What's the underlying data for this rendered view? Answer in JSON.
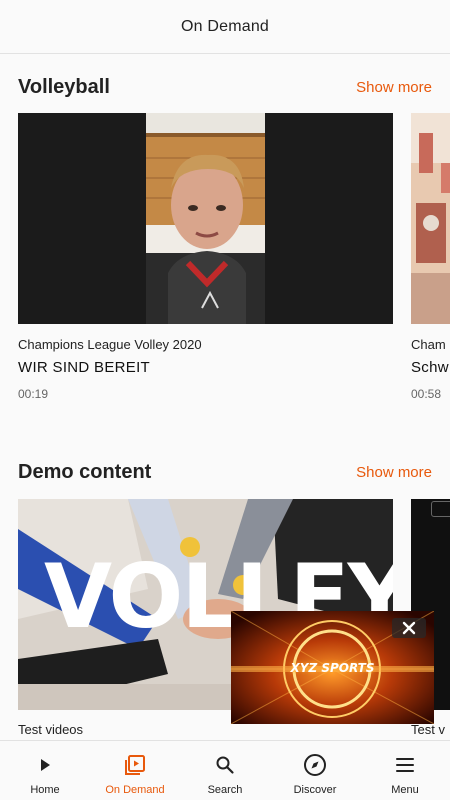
{
  "header": {
    "title": "On Demand"
  },
  "sections": [
    {
      "title": "Volleyball",
      "show_more": "Show more",
      "cards": [
        {
          "subtitle": "Champions League Volley 2020",
          "title": "WIR SIND BEREIT",
          "duration": "00:19"
        },
        {
          "subtitle": "Cham",
          "title": "Schw",
          "duration": "00:58"
        }
      ]
    },
    {
      "title": "Demo content",
      "show_more": "Show more",
      "cards": [
        {
          "subtitle": "Test videos",
          "overlay_text": "VOLLEY"
        },
        {
          "subtitle": "Test v"
        }
      ]
    }
  ],
  "mini_player": {
    "brand": "XYZ SPORTS",
    "close_icon": "close-icon"
  },
  "nav": {
    "items": [
      {
        "label": "Home",
        "icon": "play-icon",
        "active": false
      },
      {
        "label": "On Demand",
        "icon": "on-demand-icon",
        "active": true
      },
      {
        "label": "Search",
        "icon": "search-icon",
        "active": false
      },
      {
        "label": "Discover",
        "icon": "compass-icon",
        "active": false
      },
      {
        "label": "Menu",
        "icon": "menu-icon",
        "active": false
      }
    ]
  },
  "colors": {
    "accent": "#e8590c",
    "text": "#222222",
    "background": "#fafafa"
  }
}
